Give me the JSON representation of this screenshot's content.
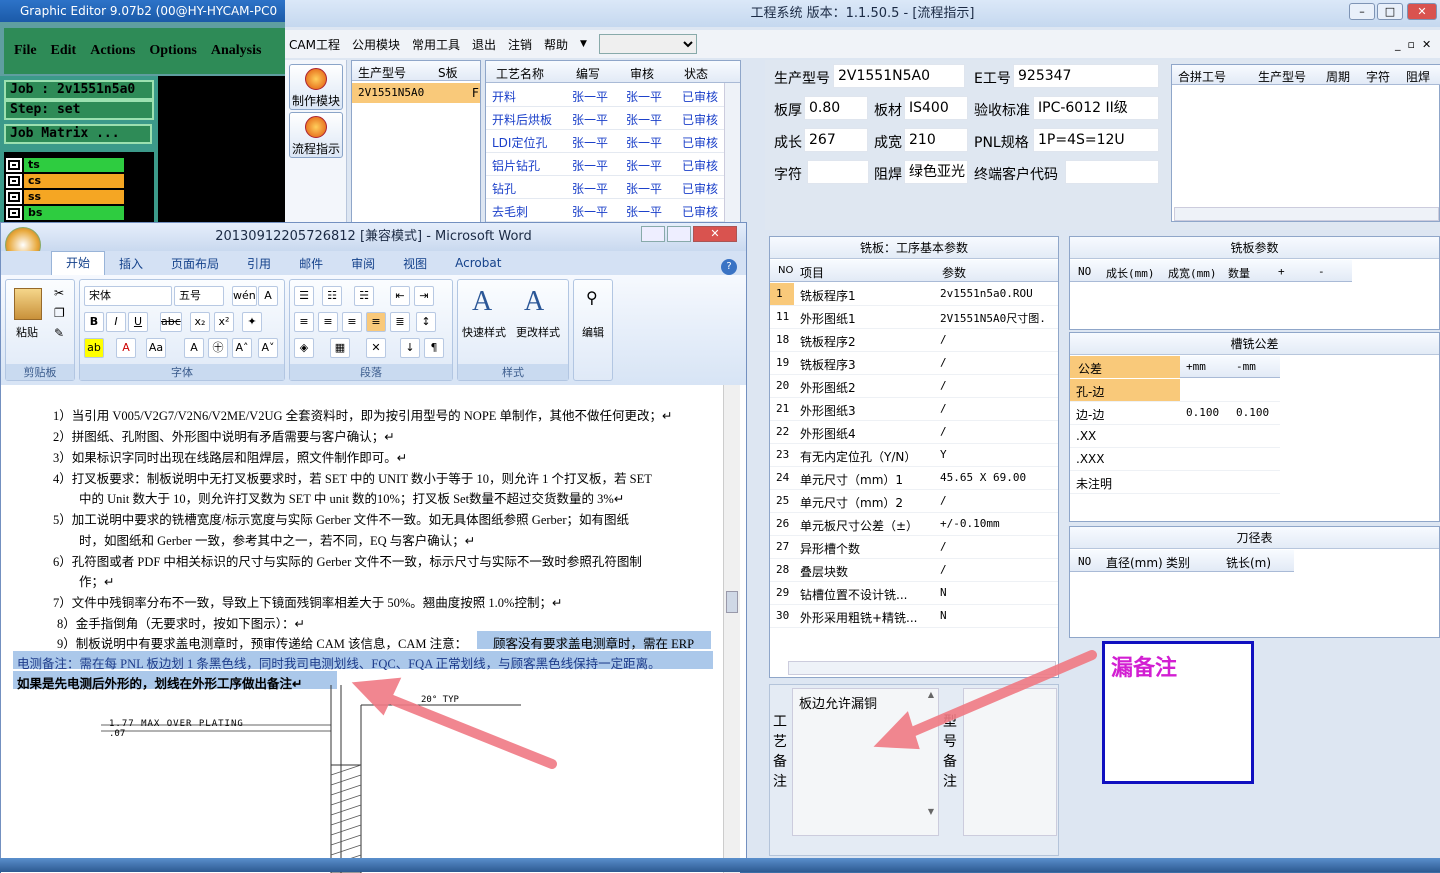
{
  "graphic_editor": {
    "title": "Graphic Editor 9.07b2 (00@HY-HYCAM-PC0",
    "menu": [
      "File",
      "Edit",
      "Actions",
      "Options",
      "Analysis"
    ],
    "job": "Job : 2v1551n5a0",
    "step": "Step: set",
    "job_matrix": "Job Matrix ...",
    "layers": [
      {
        "name": "ts",
        "color": "#2ecc40"
      },
      {
        "name": "cs",
        "color": "#f5a623"
      },
      {
        "name": "ss",
        "color": "#f5a623"
      },
      {
        "name": "bs",
        "color": "#2ecc40"
      }
    ]
  },
  "app": {
    "title": "工程系统   版本：1.1.50.5 - [流程指示]",
    "menu": [
      "CAM工程",
      "公用模块",
      "常用工具",
      "退出",
      "注销",
      "帮助"
    ],
    "left_buttons": [
      "制作模块",
      "流程指示"
    ],
    "model_list": {
      "headers": [
        "生产型号",
        "S板"
      ],
      "rows": [
        [
          "2V1551N5A0",
          "F"
        ]
      ]
    },
    "process_table": {
      "headers": [
        "工艺名称",
        "编写",
        "审核",
        "状态"
      ],
      "rows": [
        [
          "开料",
          "张一平",
          "张一平",
          "已审核"
        ],
        [
          "开料后烘板",
          "张一平",
          "张一平",
          "已审核"
        ],
        [
          "LDI定位孔",
          "张一平",
          "张一平",
          "已审核"
        ],
        [
          "铝片钻孔",
          "张一平",
          "张一平",
          "已审核"
        ],
        [
          "钻孔",
          "张一平",
          "张一平",
          "已审核"
        ],
        [
          "去毛刺",
          "张一平",
          "张一平",
          "已审核"
        ]
      ]
    },
    "info": {
      "model_label": "生产型号",
      "model": "2V1551N5A0",
      "eno_label": "E工号",
      "eno": "925347",
      "thick_label": "板厚",
      "thick": "0.80",
      "material_label": "板材",
      "material": "IS400",
      "std_label": "验收标准",
      "std": "IPC-6012 II级",
      "len_label": "成长",
      "len": "267",
      "wid_label": "成宽",
      "wid": "210",
      "pnl_label": "PNL规格",
      "pnl": "1P=4S=12U",
      "char_label": "字符",
      "char": "",
      "mask_label": "阻焊",
      "mask": "绿色亚光",
      "cust_label": "终端客户代码",
      "cust": ""
    },
    "combine_table": {
      "headers": [
        "合拼工号",
        "生产型号",
        "周期",
        "字符",
        "阻焊"
      ]
    },
    "mill_params": {
      "title": "铣板：工序基本参数",
      "headers": [
        "NO",
        "项目",
        "参数"
      ],
      "rows": [
        [
          "1",
          "铣板程序1",
          "2v1551n5a0.ROU"
        ],
        [
          "11",
          "外形图纸1",
          "2V1551N5A0尺寸图."
        ],
        [
          "18",
          "铣板程序2",
          "/"
        ],
        [
          "19",
          "铣板程序3",
          "/"
        ],
        [
          "20",
          "外形图纸2",
          "/"
        ],
        [
          "21",
          "外形图纸3",
          "/"
        ],
        [
          "22",
          "外形图纸4",
          "/"
        ],
        [
          "23",
          "有无内定位孔（Y/N）",
          "Y"
        ],
        [
          "24",
          "单元尺寸（mm）1",
          "45.65 X 69.00"
        ],
        [
          "25",
          "单元尺寸（mm）2",
          "/"
        ],
        [
          "26",
          "单元板尺寸公差（±）",
          "+/-0.10mm"
        ],
        [
          "27",
          "异形槽个数",
          "/"
        ],
        [
          "28",
          "叠层块数",
          "/"
        ],
        [
          "29",
          "钻槽位置不设计铣...",
          "N"
        ],
        [
          "30",
          "外形采用粗铣+精铣...",
          "N"
        ]
      ]
    },
    "board_params": {
      "title": "铣板参数",
      "headers": [
        "NO",
        "成长(mm)",
        "成宽(mm)",
        "数量",
        "+",
        "-"
      ]
    },
    "slot_tol": {
      "title": "槽铣公差",
      "headers": [
        "公差",
        "+mm",
        "-mm"
      ],
      "rows": [
        [
          "孔-边",
          "",
          ""
        ],
        [
          "边-边",
          "0.100",
          "0.100"
        ],
        [
          ".XX",
          "",
          ""
        ],
        [
          ".XXX",
          "",
          ""
        ],
        [
          "未注明",
          "",
          ""
        ]
      ]
    },
    "tool_table": {
      "title": "刀径表",
      "headers": [
        "NO",
        "直径(mm)",
        "类别",
        "铣长(m)"
      ]
    },
    "process_note_label": [
      "工",
      "艺",
      "备",
      "注"
    ],
    "process_note": "板边允许漏铜",
    "model_note_label": [
      "型",
      "号",
      "备",
      "注"
    ],
    "annotation": "漏备注"
  },
  "word": {
    "title": "20130912205726812 [兼容模式] - Microsoft Word",
    "tabs": [
      "开始",
      "插入",
      "页面布局",
      "引用",
      "邮件",
      "审阅",
      "视图",
      "Acrobat"
    ],
    "groups": [
      "剪贴板",
      "字体",
      "段落",
      "样式",
      "编辑"
    ],
    "paste": "粘贴",
    "font_name": "宋体",
    "font_size": "五号",
    "quick_style": "快速样式",
    "change_style": "更改样式",
    "edit": "编辑",
    "lines": [
      "1）当引用 V005/V2G7/V2N6/V2ME/V2UG 全套资料时，即为按引用型号的 NOPE 单制作，其他不做任何更改；↵",
      "2）拼图纸、孔附图、外形图中说明有矛盾需要与客户确认；↵",
      "3）如果标识字同时出现在线路层和阻焊层，照文件制作即可。↵",
      "4）打叉板要求：制板说明中无打叉板要求时，若 SET 中的 UNIT 数小于等于 10，则允许 1 个打叉板，若 SET",
      "中的 Unit 数大于 10，则允许打叉数为 SET 中 unit 数的10%；打叉板 Set数量不超过交货数量的 3%↵",
      "5）加工说明中要求的铣槽宽度/标示宽度与实际 Gerber 文件不一致。如无具体图纸参照 Gerber；如有图纸",
      "时，如图纸和 Gerber 一致，参考其中之一，若不同，EQ 与客户确认；↵",
      "6）孔符图或者 PDF 中相关标识的尺寸与实际的 Gerber 文件不一致，标示尺寸与实际不一致时参照孔符图制",
      "作；↵",
      "7）文件中残铜率分布不一致，导致上下镜面残铜率相差大于 50%。翘曲度按照 1.0%控制；↵",
      "8）金手指倒角（无要求时，按如下图示）：↵",
      "9）制板说明中有要求盖电测章时，预审传递给 CAM 该信息，CAM 注意：",
      "顾客没有要求盖电测章时，需在 ERP",
      "电测备注：需在每 PNL 板边划 1 条黑色线，同时我司电测划线、FQC、FQA 正常划线，与顾客黑色线保持一定距离。",
      "如果是先电测后外形的，划线在外形工序做出备注↵"
    ],
    "drawing_text": "1.77 MAX OVER PLATING",
    "drawing_text2": ".07",
    "drawing_angle": "20° TYP"
  },
  "colors": {
    "arrow": "#f07a84",
    "annotation": "#d21fd2",
    "box": "#1010c0"
  }
}
